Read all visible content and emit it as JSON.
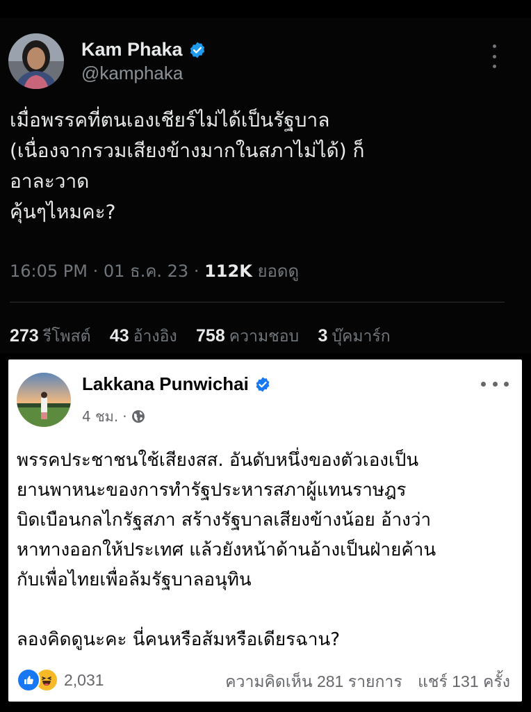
{
  "x_post": {
    "display_name": "Kam Phaka",
    "handle": "@kamphaka",
    "text_lines": [
      "เมื่อพรรคที่ตนเองเชียร์ไม่ได้เป็นรัฐบาล",
      "(เนื่องจากรวมเสียงข้างมากในสภาไม่ได้) ก็",
      "อาละวาด",
      "คุ้นๆไหมคะ?"
    ],
    "time": "16:05 PM",
    "date": "01 ธ.ค. 23",
    "views_count": "112K",
    "views_label": "ยอดดู",
    "stats": [
      {
        "count": "273",
        "label": "รีโพสต์"
      },
      {
        "count": "43",
        "label": "อ้างอิง"
      },
      {
        "count": "758",
        "label": "ความชอบ"
      },
      {
        "count": "3",
        "label": "บุ๊คมาร์ก"
      }
    ],
    "colors": {
      "verified": "#1d9bf0",
      "background": "#050505"
    }
  },
  "fb_post": {
    "display_name": "Lakkana Punwichai",
    "time_ago": "4 ชม.",
    "separator": "·",
    "audience_icon": "globe-icon",
    "text_lines": [
      "พรรคประชาชนใช้เสียงสส. อันดับหนึ่งของตัวเองเป็น",
      "ยานพาหนะของการทำรัฐประหารสภาผู้แทนราษฎร",
      "บิดเบือนกลไกรัฐสภา สร้างรัฐบาลเสียงข้างน้อย อ้างว่า",
      "หาทางออกให้ประเทศ แล้วยังหน้าด้านอ้างเป็นฝ่ายค้าน",
      "กับเพื่อไทยเพื่อล้มรัฐบาลอนุทิน"
    ],
    "closing_line": "ลองคิดดูนะคะ นี่คนหรือส้มหรือเดียรฉาน?",
    "reactions_count": "2,031",
    "comments_text": "ความคิดเห็น 281 รายการ",
    "shares_text": "แชร์ 131 ครั้ง",
    "colors": {
      "like": "#1877f2",
      "haha": "#f7b928",
      "verified": "#1877f2"
    }
  }
}
